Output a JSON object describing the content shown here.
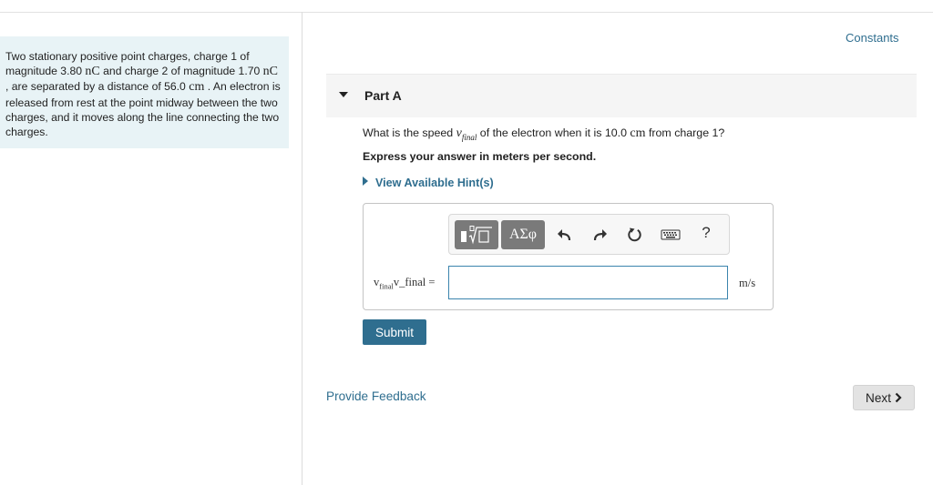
{
  "problem": {
    "t1": "Two stationary positive point charges, charge 1 of magnitude 3.80 ",
    "u1": "nC",
    "t2": " and charge 2 of magnitude 1.70 ",
    "u2": "nC",
    "t3": " , are separated by a distance of 56.0 ",
    "u3": "cm",
    "t4": " . An electron is released from rest at the point midway between the two charges, and it moves along the line connecting the two charges."
  },
  "constants_link": "Constants",
  "part": {
    "title": "Part A"
  },
  "question": {
    "before": "What is the speed ",
    "var": "v",
    "var_sub": "final",
    "middle": " of the electron when it is 10.0 ",
    "unit": "cm",
    "after": " from charge 1?"
  },
  "instruction": "Express your answer in meters per second.",
  "hints_link": "View Available Hint(s)",
  "toolbar": {
    "greek_label": "ΑΣφ",
    "help_label": "?",
    "icons": [
      "template-icon",
      "greek-letters-icon",
      "undo-icon",
      "redo-icon",
      "reset-icon",
      "keyboard-icon",
      "help-icon"
    ]
  },
  "answer": {
    "label_var": "v",
    "label_sub": "final",
    "label_raw": "v_final",
    "equals": " =",
    "value": "",
    "unit": "m/s"
  },
  "submit_label": "Submit",
  "feedback_link": "Provide Feedback",
  "next_label": "Next",
  "colors": {
    "accent": "#2f6e8f",
    "problem_bg": "#e8f3f6",
    "toolbar_button": "#7a7a7a"
  }
}
